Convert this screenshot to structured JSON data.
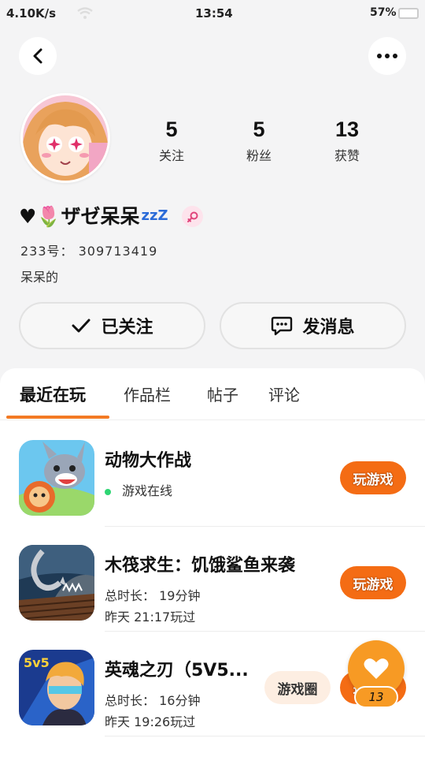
{
  "status_bar": {
    "net_speed": "4.10K/s",
    "time": "13:54",
    "battery": "57%"
  },
  "header": {
    "back_icon": "chevron-left-icon",
    "more_icon": "more-dots-icon"
  },
  "profile": {
    "name": "♥🌷ザゼ呆呆",
    "name_suffix": "zzZ",
    "gender": "female",
    "uid": "233号： 309713419",
    "bio": "呆呆的",
    "stats": [
      {
        "value": "5",
        "label": "关注"
      },
      {
        "value": "5",
        "label": "粉丝"
      },
      {
        "value": "13",
        "label": "获赞"
      }
    ]
  },
  "actions": {
    "follow": "已关注",
    "message": "发消息"
  },
  "tabs": [
    {
      "label": "最近在玩",
      "active": true
    },
    {
      "label": "作品栏",
      "active": false
    },
    {
      "label": "帖子",
      "active": false
    },
    {
      "label": "评论",
      "active": false
    }
  ],
  "games": [
    {
      "name": "动物大作战",
      "status": "游戏在线",
      "button": "玩游戏"
    },
    {
      "name": "木筏求生：饥饿鲨鱼来袭",
      "playtime": "总时长： 19分钟",
      "last_played": "昨天 21:17玩过",
      "button": "玩游戏"
    },
    {
      "name": "英魂之刃（5V5...",
      "playtime": "总时长： 16分钟",
      "last_played": "昨天 19:26玩过",
      "tag": "游戏圈",
      "button": "玩游戏"
    }
  ],
  "like_fab": {
    "count": "13"
  },
  "colors": {
    "accent": "#f46c14",
    "fab": "#f79a24",
    "tab_indicator": "#f37a24",
    "online": "#2ed573"
  }
}
